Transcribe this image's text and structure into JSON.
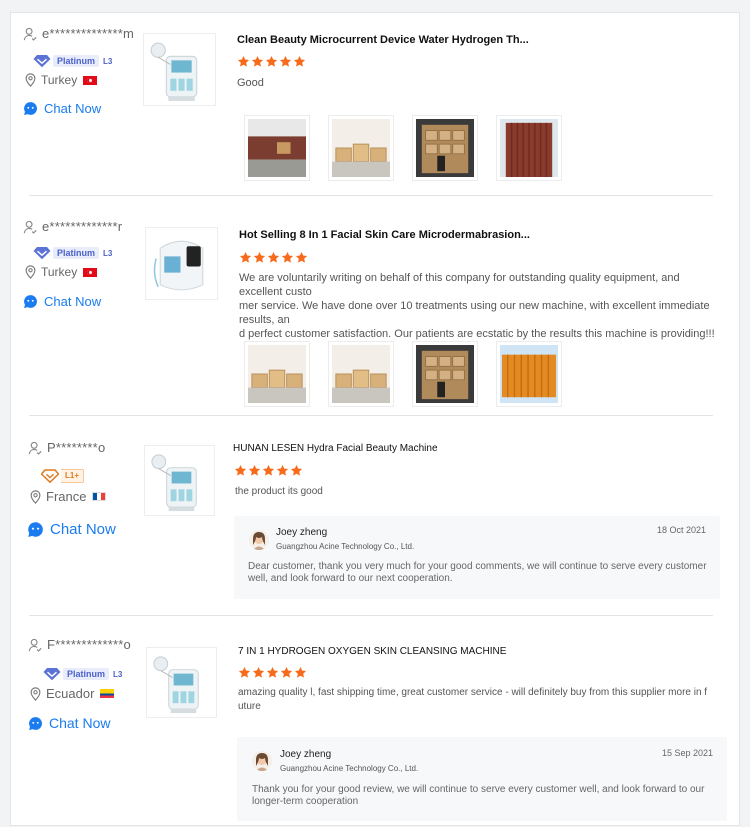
{
  "icons": {
    "user": "user-icon",
    "pin": "location-pin-icon",
    "chat": "chat-bubble-icon",
    "star": "star-icon",
    "badge": "diamond-badge-icon"
  },
  "colors": {
    "star": "#f76b1c",
    "chat": "#1a7cf0",
    "platinum": "#4c63c7",
    "l1": "#e07a1f"
  },
  "reviews": [
    {
      "user": "e**************m",
      "badge": "Platinum",
      "level": "L3",
      "country": "Turkey",
      "chat": "Chat Now",
      "product_title": "Clean Beauty Microcurrent Device Water Hydrogen Th...",
      "rating": 5,
      "text": "Good"
    },
    {
      "user": "e*************r",
      "badge": "Platinum",
      "level": "L3",
      "country": "Turkey",
      "chat": "Chat Now",
      "product_title": "Hot Selling 8 In 1 Facial Skin Care Microdermabrasion...",
      "rating": 5,
      "text_lines": [
        "We are voluntarily writing on behalf of this company for outstanding quality equipment, and excellent custo",
        "mer service. We have done over 10 treatments using our new machine, with excellent immediate results, an",
        "d perfect customer satisfaction. Our patients are ecstatic by the results this machine is providing!!!"
      ]
    },
    {
      "user": "P********o",
      "badge": "L1+",
      "country": "France",
      "chat": "Chat Now",
      "product_title": "HUNAN LESEN  Hydra Facial Beauty Machine",
      "rating": 5,
      "text": "the product its good",
      "reply": {
        "name": "Joey zheng",
        "company": "Guangzhou Acine Technology Co., Ltd.",
        "date": "18 Oct 2021",
        "text_lines": [
          "Dear customer, thank you very much for your good comments, we will continue to serve every customer",
          "well, and look forward to our next cooperation."
        ]
      }
    },
    {
      "user": "F*************o",
      "badge": "Platinum",
      "level": "L3",
      "country": "Ecuador",
      "chat": "Chat Now",
      "product_title": "7 IN 1 HYDROGEN OXYGEN SKIN CLEANSING MACHINE",
      "rating": 5,
      "text_lines": [
        "amazing quality l, fast shipping time, great customer service - will definitely buy from this supplier more in f",
        "uture"
      ],
      "reply": {
        "name": "Joey zheng",
        "company": "Guangzhou Acine Technology Co., Ltd.",
        "date": "15 Sep 2021",
        "text_lines": [
          "Thank you for your good review, we will continue to serve every customer well, and look forward to our",
          "longer-term cooperation"
        ]
      }
    }
  ]
}
